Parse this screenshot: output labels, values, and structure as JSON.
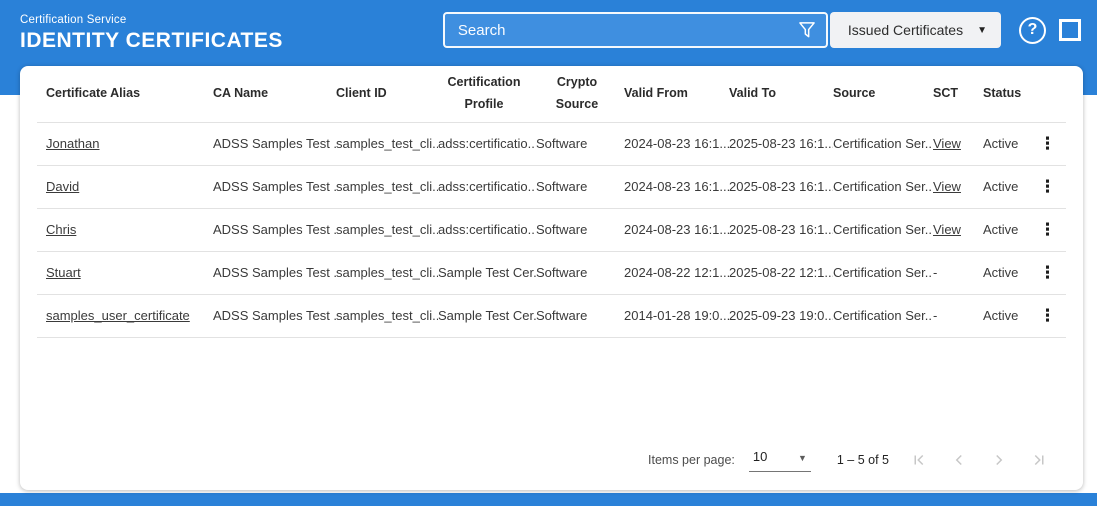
{
  "header": {
    "service_label": "Certification Service",
    "page_title": "IDENTITY CERTIFICATES",
    "search_placeholder": "Search",
    "filter_dropdown_value": "Issued Certificates"
  },
  "icons": {
    "filter_icon": "funnel",
    "dropdown_caret": "▼",
    "help_glyph": "?",
    "row_menu_glyph": "⋮",
    "select_caret": "▼"
  },
  "colors": {
    "appbar_blue": "#2a81d8",
    "search_field_blue": "#3f8fe0",
    "dropdown_bg": "#f1f2f4",
    "row_divider": "#e2e2e2",
    "disabled_icon": "#c7c7c7"
  },
  "table": {
    "columns": [
      {
        "key": "alias",
        "label": "Certificate Alias",
        "align": "left"
      },
      {
        "key": "ca_name",
        "label": "CA Name",
        "align": "left"
      },
      {
        "key": "client_id",
        "label": "Client ID",
        "align": "left"
      },
      {
        "key": "profile",
        "label": "Certification Profile",
        "align": "center"
      },
      {
        "key": "crypto",
        "label": "Crypto Source",
        "align": "center"
      },
      {
        "key": "valid_from",
        "label": "Valid From",
        "align": "left"
      },
      {
        "key": "valid_to",
        "label": "Valid To",
        "align": "left"
      },
      {
        "key": "source",
        "label": "Source",
        "align": "left"
      },
      {
        "key": "sct",
        "label": "SCT",
        "align": "left"
      },
      {
        "key": "status",
        "label": "Status",
        "align": "left"
      },
      {
        "key": "menu",
        "label": "",
        "align": "left"
      }
    ],
    "rows": [
      {
        "alias": "Jonathan",
        "ca_name": "ADSS Samples Test ...",
        "client_id": "samples_test_cli...",
        "profile": "adss:certificatio...",
        "crypto": "Software",
        "valid_from": "2024-08-23 16:1...",
        "valid_to": "2025-08-23 16:1...",
        "source": "Certification Ser...",
        "sct": "View",
        "status": "Active"
      },
      {
        "alias": "David",
        "ca_name": "ADSS Samples Test ...",
        "client_id": "samples_test_cli...",
        "profile": "adss:certificatio...",
        "crypto": "Software",
        "valid_from": "2024-08-23 16:1...",
        "valid_to": "2025-08-23 16:1...",
        "source": "Certification Ser...",
        "sct": "View",
        "status": "Active"
      },
      {
        "alias": "Chris",
        "ca_name": "ADSS Samples Test ...",
        "client_id": "samples_test_cli...",
        "profile": "adss:certificatio...",
        "crypto": "Software",
        "valid_from": "2024-08-23 16:1...",
        "valid_to": "2025-08-23 16:1...",
        "source": "Certification Ser...",
        "sct": "View",
        "status": "Active"
      },
      {
        "alias": "Stuart",
        "ca_name": "ADSS Samples Test ...",
        "client_id": "samples_test_cli...",
        "profile": "Sample Test Cer...",
        "crypto": "Software",
        "valid_from": "2024-08-22 12:1...",
        "valid_to": "2025-08-22 12:1...",
        "source": "Certification Ser...",
        "sct": "-",
        "status": "Active"
      },
      {
        "alias": "samples_user_certificate",
        "ca_name": "ADSS Samples Test ...",
        "client_id": "samples_test_cli...",
        "profile": "Sample Test Cer...",
        "crypto": "Software",
        "valid_from": "2014-01-28 19:0...",
        "valid_to": "2025-09-23 19:0...",
        "source": "Certification Ser...",
        "sct": "-",
        "status": "Active"
      }
    ]
  },
  "pagination": {
    "items_per_page_label": "Items per page:",
    "items_per_page_value": "10",
    "range_label": "1 – 5 of 5"
  }
}
